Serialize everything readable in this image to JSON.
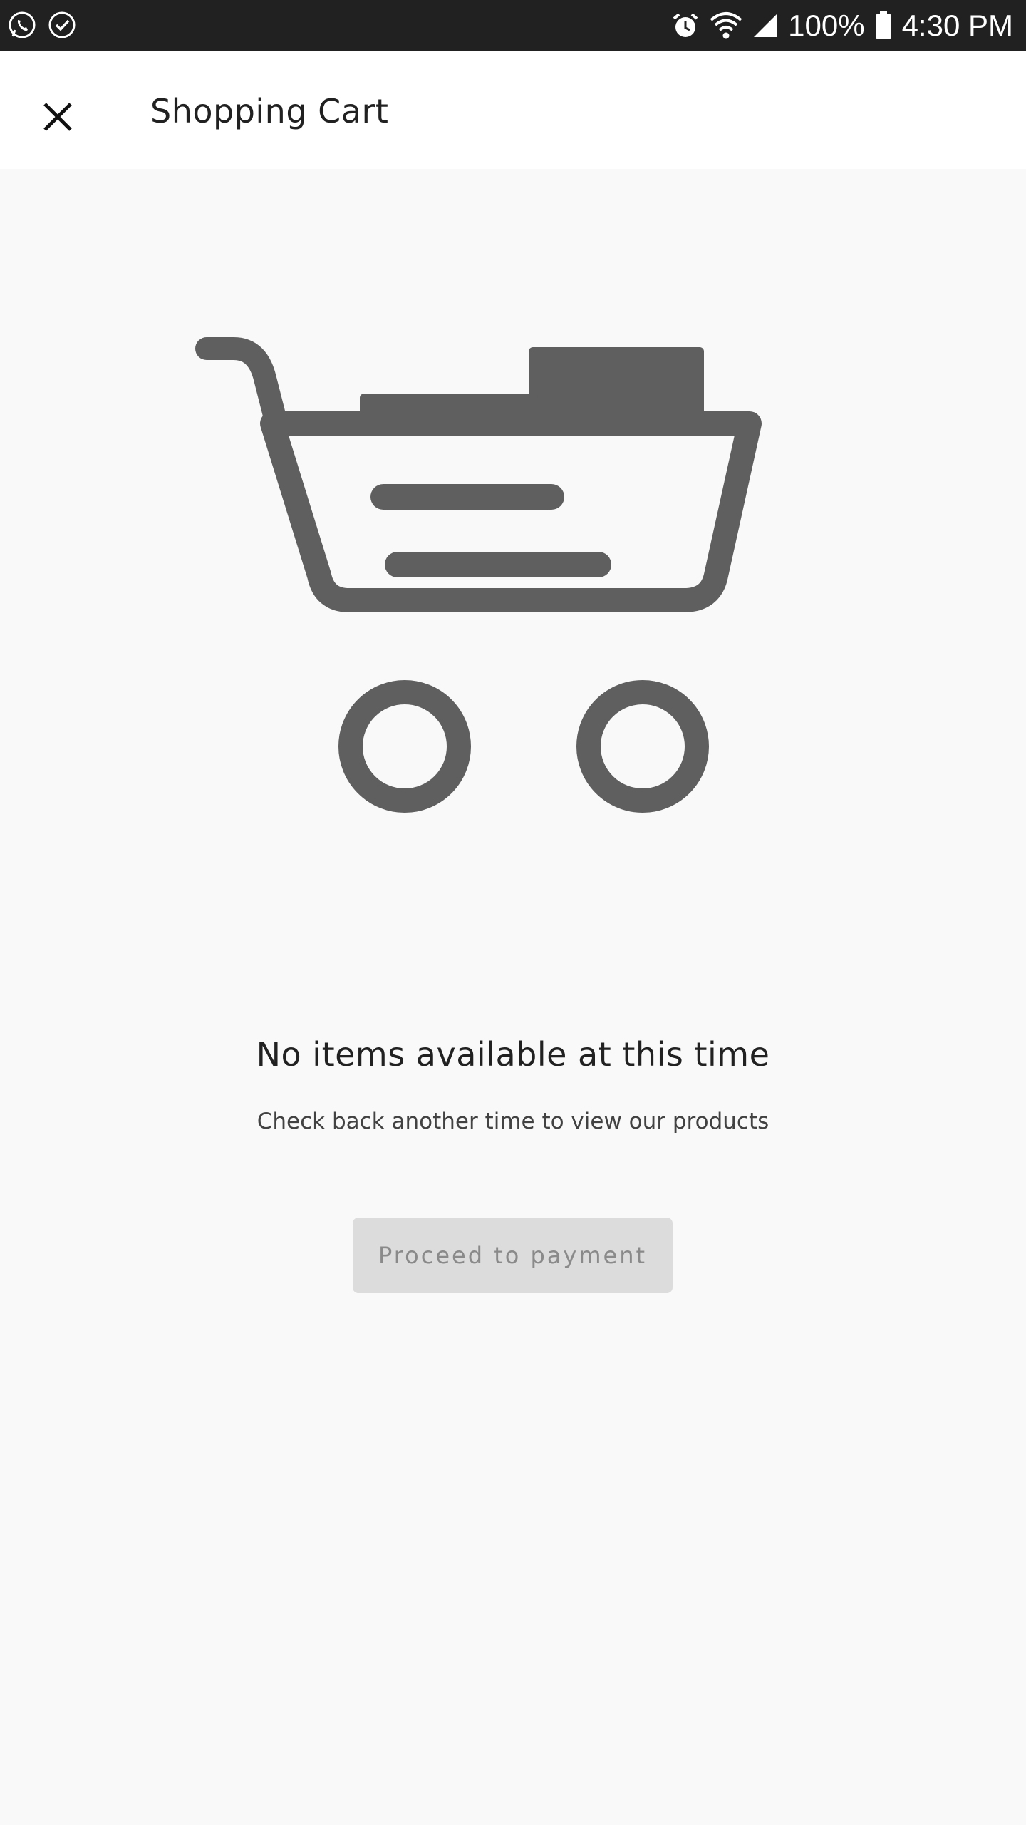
{
  "status_bar": {
    "battery_percent": "100%",
    "time": "4:30 PM",
    "left_icons": [
      "whatsapp-icon",
      "check-circle-icon"
    ],
    "right_icons": [
      "alarm-icon",
      "wifi-icon",
      "signal-icon",
      "battery-icon"
    ]
  },
  "app_bar": {
    "title": "Shopping Cart",
    "close_icon": "close-icon"
  },
  "empty_state": {
    "illustration": "shopping-cart-icon",
    "title": "No items available at this time",
    "subtitle": "Check back another time to view our products"
  },
  "actions": {
    "proceed_label": "Proceed to payment"
  },
  "colors": {
    "status_bar_bg": "#212121",
    "app_bar_bg": "#ffffff",
    "page_bg": "#f9f9f9",
    "illustration": "#5f5f5f",
    "button_disabled_bg": "#dcdcdc",
    "button_disabled_text": "#8a8a8a"
  }
}
